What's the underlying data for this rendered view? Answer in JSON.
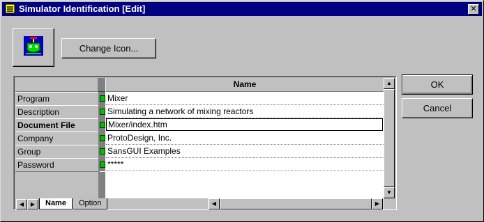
{
  "window": {
    "title": "Simulator Identification [Edit]",
    "close_glyph": "✕"
  },
  "change_icon_label": "Change Icon...",
  "ok_label": "OK",
  "cancel_label": "Cancel",
  "grid": {
    "column_header": "Name",
    "rows": [
      {
        "label": "Program",
        "value": "Mixer",
        "bold": false
      },
      {
        "label": "Description",
        "value": "Simulating a network of mixing reactors",
        "bold": false
      },
      {
        "label": "Document File",
        "value": "Mixer/index.htm",
        "bold": true
      },
      {
        "label": "Company",
        "value": "ProtoDesign, Inc.",
        "bold": false
      },
      {
        "label": "Group",
        "value": "SansGUI Examples",
        "bold": false
      },
      {
        "label": "Password",
        "value": "*****",
        "bold": false
      }
    ]
  },
  "tabs": [
    "Name",
    "Option"
  ],
  "icons": {
    "app": "database-icon",
    "simulator": "mixing-reactor-icon",
    "led": "green-led-icon"
  },
  "colors": {
    "titlebar": "#000080",
    "led": "#00c000"
  }
}
